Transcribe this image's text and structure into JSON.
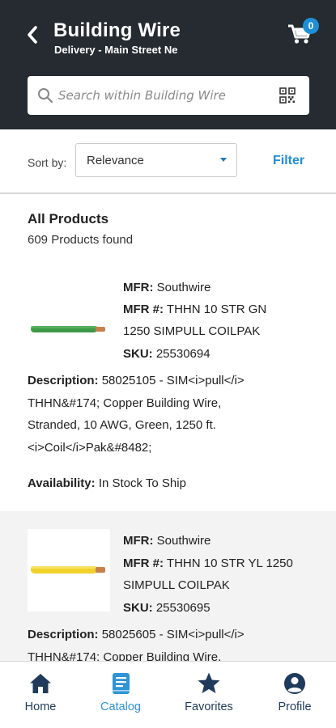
{
  "header": {
    "title": "Building Wire",
    "subtitle": "Delivery - Main Street Ne",
    "cart_count": "0"
  },
  "search": {
    "placeholder": "Search within Building Wire"
  },
  "sort": {
    "label": "Sort by:",
    "value": "Relevance",
    "filter_label": "Filter"
  },
  "results": {
    "title": "All Products",
    "count": "609 Products found"
  },
  "labels": {
    "mfr": "MFR:",
    "mfr_num": "MFR #:",
    "sku": "SKU:",
    "description": "Description:",
    "availability": "Availability:"
  },
  "products": [
    {
      "mfr": "Southwire",
      "mfr_num_line1": "THHN 10 STR GN",
      "mfr_num_line2": "1250 SIMPULL COILPAK",
      "sku": "25530694",
      "desc_line1": "58025105 - SIM<i>pull</i>",
      "desc_line2": "THHN&#174; Copper Building Wire,",
      "desc_line3": "Stranded, 10 AWG, Green, 1250 ft.",
      "desc_line4": "<i>Coil</i>Pak&#8482;",
      "availability": "In Stock To Ship",
      "wire_color": "#3f9a48"
    },
    {
      "mfr": "Southwire",
      "mfr_num_line1": "THHN 10 STR YL 1250",
      "mfr_num_line2": "SIMPULL COILPAK",
      "sku": "25530695",
      "desc_line1": "58025605 - SIM<i>pull</i>",
      "desc_line2": "THHN&#174; Copper Building Wire,",
      "wire_color": "#f0d22a"
    }
  ],
  "nav": {
    "items": [
      {
        "label": "Home",
        "icon": "home-icon"
      },
      {
        "label": "Catalog",
        "icon": "catalog-icon"
      },
      {
        "label": "Favorites",
        "icon": "star-icon"
      },
      {
        "label": "Profile",
        "icon": "profile-icon"
      }
    ],
    "active": "Catalog"
  },
  "colors": {
    "header_bg": "#262b31",
    "accent": "#2f95d6",
    "nav_text": "#1f3a5a"
  }
}
